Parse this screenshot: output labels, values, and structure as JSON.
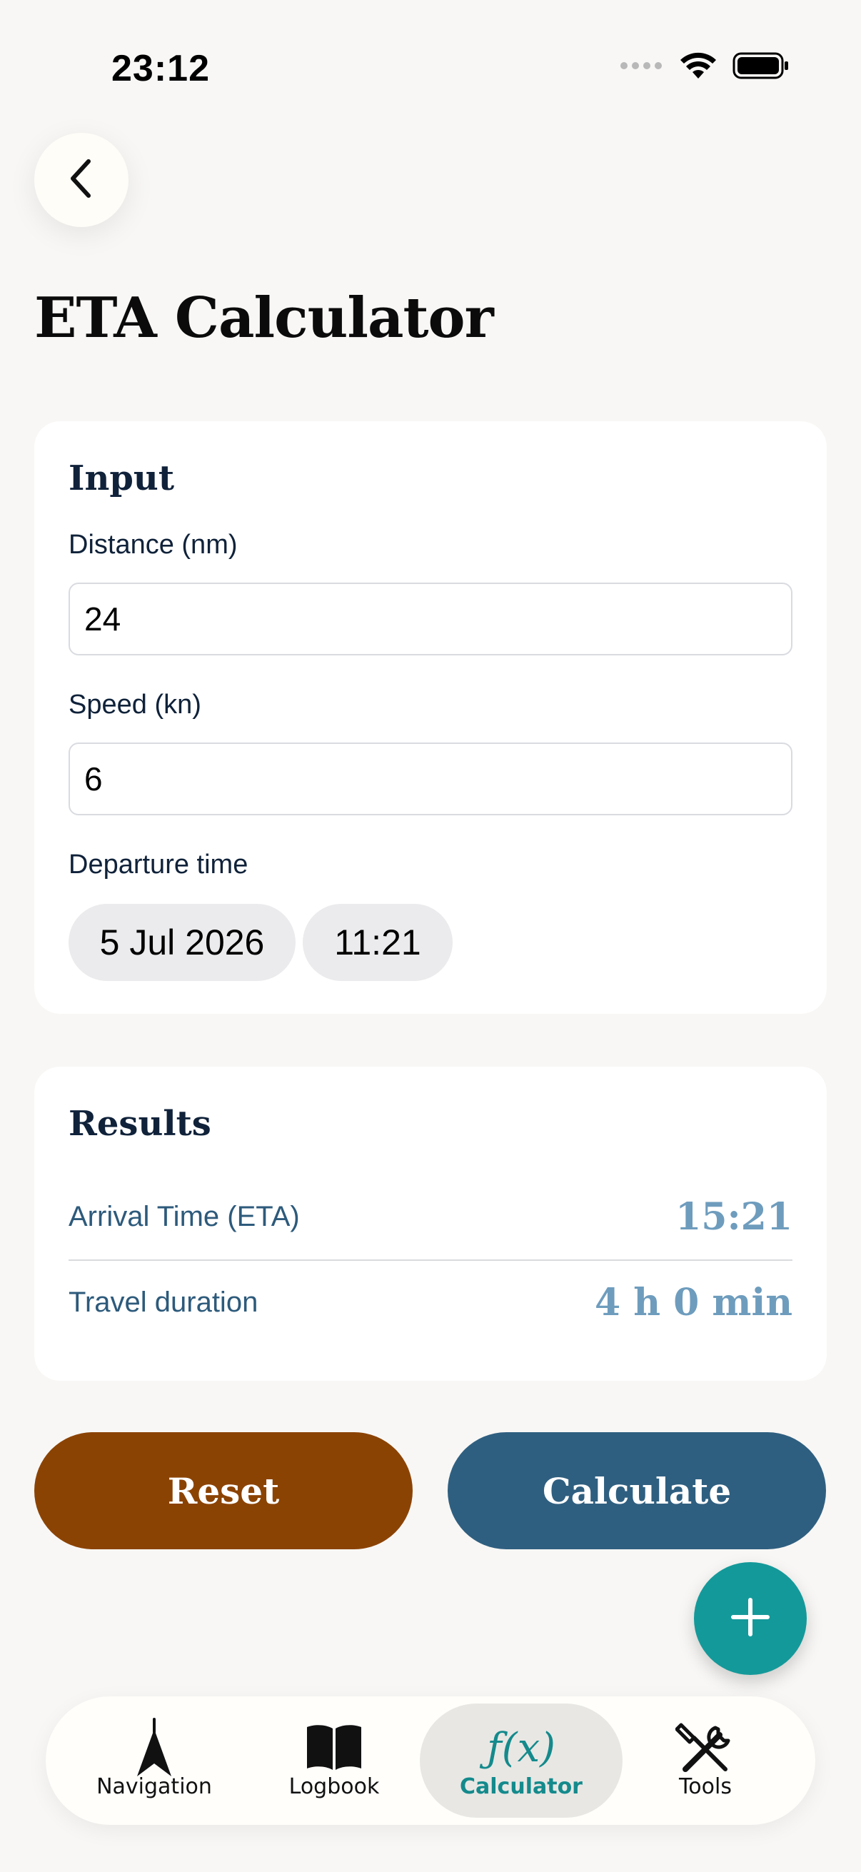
{
  "status": {
    "time": "23:12"
  },
  "header": {
    "title": "ETA Calculator"
  },
  "input_card": {
    "title": "Input",
    "distance_label": "Distance (nm)",
    "distance_value": "24",
    "speed_label": "Speed (kn)",
    "speed_value": "6",
    "departure_label": "Departure time",
    "departure_date": "5 Jul 2026",
    "departure_time": "11:21"
  },
  "results_card": {
    "title": "Results",
    "rows": [
      {
        "label": "Arrival Time (ETA)",
        "value": "15:21"
      },
      {
        "label": "Travel duration",
        "value": "4 h 0 min"
      }
    ]
  },
  "actions": {
    "reset_label": "Reset",
    "calculate_label": "Calculate"
  },
  "tabs": [
    {
      "label": "Navigation",
      "icon": "navigation-arrow-icon",
      "active": false
    },
    {
      "label": "Logbook",
      "icon": "book-icon",
      "active": false
    },
    {
      "label": "Calculator",
      "icon": "function-icon",
      "icon_text": "ƒ(x)",
      "active": true
    },
    {
      "label": "Tools",
      "icon": "tools-icon",
      "active": false
    }
  ],
  "colors": {
    "background": "#f8f7f5",
    "reset": "#8b4304",
    "calculate": "#2f5f80",
    "fab": "#14999a",
    "accent": "#148a8c",
    "result_value": "#6e9cbd"
  }
}
